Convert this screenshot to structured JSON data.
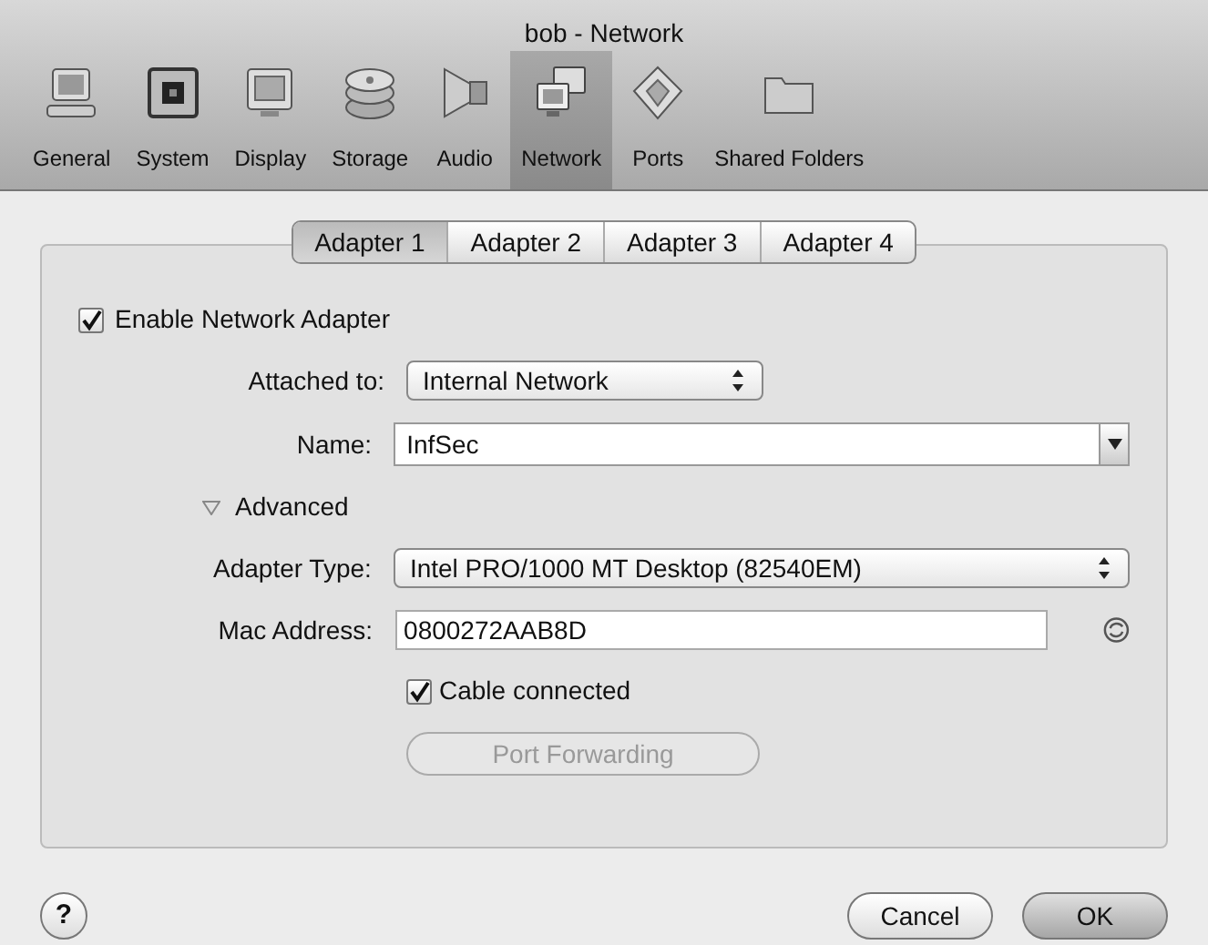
{
  "window": {
    "title": "bob - Network"
  },
  "toolbar": [
    {
      "kind": "general",
      "label": "General",
      "selected": false
    },
    {
      "kind": "system",
      "label": "System",
      "selected": false
    },
    {
      "kind": "display",
      "label": "Display",
      "selected": false
    },
    {
      "kind": "storage",
      "label": "Storage",
      "selected": false
    },
    {
      "kind": "audio",
      "label": "Audio",
      "selected": false
    },
    {
      "kind": "network",
      "label": "Network",
      "selected": true
    },
    {
      "kind": "ports",
      "label": "Ports",
      "selected": false
    },
    {
      "kind": "folders",
      "label": "Shared Folders",
      "selected": false
    }
  ],
  "tabs": [
    {
      "label": "Adapter 1",
      "selected": true
    },
    {
      "label": "Adapter 2",
      "selected": false
    },
    {
      "label": "Adapter 3",
      "selected": false
    },
    {
      "label": "Adapter 4",
      "selected": false
    }
  ],
  "enable_adapter": {
    "label": "Enable Network Adapter",
    "checked": true
  },
  "attached_to": {
    "label": "Attached to:",
    "value": "Internal Network"
  },
  "name": {
    "label": "Name:",
    "value": "InfSec"
  },
  "advanced": {
    "label": "Advanced",
    "expanded": true
  },
  "adapter_type": {
    "label": "Adapter Type:",
    "value": "Intel PRO/1000 MT Desktop (82540EM)"
  },
  "mac_address": {
    "label": "Mac Address:",
    "value": "0800272AAB8D"
  },
  "cable_connected": {
    "label": "Cable connected",
    "checked": true
  },
  "port_forwarding": {
    "label": "Port Forwarding",
    "disabled": true
  },
  "help": {
    "label": "?"
  },
  "buttons": [
    {
      "label": "Cancel",
      "kind": "cancel"
    },
    {
      "label": "OK",
      "kind": "default"
    }
  ]
}
